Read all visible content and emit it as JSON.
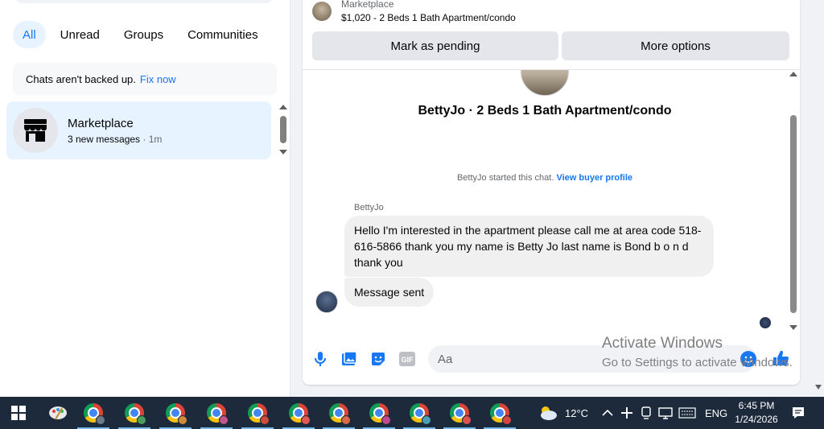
{
  "filters": [
    "All",
    "Unread",
    "Groups",
    "Communities"
  ],
  "backup": {
    "text": "Chats aren't backed up.",
    "link": "Fix now"
  },
  "chat_list": [
    {
      "name": "Marketplace",
      "subtitle": "3 new messages",
      "time": " · 1m"
    }
  ],
  "listing": {
    "label": "Marketplace",
    "title": "$1,020 - 2 Beds 1 Bath Apartment/condo"
  },
  "actions": {
    "pending": "Mark as pending",
    "more": "More options"
  },
  "conversation": {
    "title": "BettyJo · 2 Beds 1 Bath Apartment/condo",
    "started_text": "BettyJo started this chat.",
    "started_link": "View buyer profile",
    "sender": "BettyJo",
    "messages": [
      "Hello I'm interested in the apartment please call me at area code 518-616-5866 thank you my name is Betty Jo last name is Bond b o n d thank you",
      "Message sent"
    ]
  },
  "composer": {
    "placeholder": "Aa"
  },
  "watermark": {
    "line1": "Activate Windows",
    "line2": "Go to Settings to activate Windows."
  },
  "taskbar": {
    "weather": "12°C",
    "lang": "ENG",
    "time": "6:45 PM",
    "date": "1/24/2026",
    "apps": [
      {
        "profile": "#6c7a89"
      },
      {
        "profile": "#4a9d5b"
      },
      {
        "profile": "#d08a3c"
      },
      {
        "profile": "#c2558f"
      },
      {
        "profile": "#d44a3a"
      },
      {
        "profile": "#e05858"
      },
      {
        "profile": "#d86a4a"
      },
      {
        "profile": "#c04a8e"
      },
      {
        "profile": "#49a0b5"
      },
      {
        "profile": "#e05050"
      },
      {
        "profile": "#d64545"
      }
    ]
  },
  "colors": {
    "accent": "#1877f2",
    "taskbar": "#1c2a3c"
  }
}
